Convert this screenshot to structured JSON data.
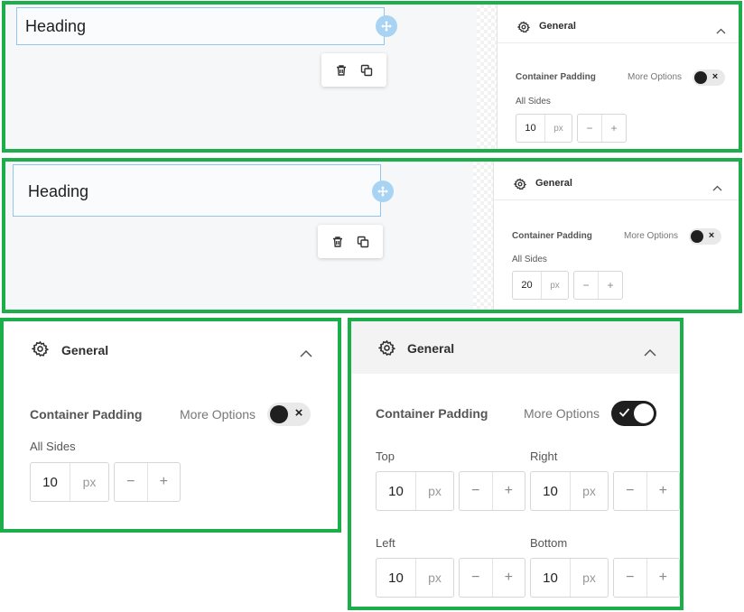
{
  "editor_views": [
    {
      "heading": "Heading",
      "panel": {
        "title": "General",
        "container_padding_label": "Container Padding",
        "more_options_label": "More Options",
        "more_options_state": "off",
        "all_sides_label": "All Sides",
        "value": "10",
        "unit": "px"
      }
    },
    {
      "heading": "Heading",
      "panel": {
        "title": "General",
        "container_padding_label": "Container Padding",
        "more_options_label": "More Options",
        "more_options_state": "off",
        "all_sides_label": "All Sides",
        "value": "20",
        "unit": "px"
      }
    }
  ],
  "panel_collapsed_options": {
    "title": "General",
    "container_padding_label": "Container Padding",
    "more_options_label": "More Options",
    "more_options_state": "off",
    "all_sides_label": "All Sides",
    "value": "10",
    "unit": "px",
    "minus": "−",
    "plus": "+"
  },
  "panel_expanded_options": {
    "title": "General",
    "container_padding_label": "Container Padding",
    "more_options_label": "More Options",
    "more_options_state": "on",
    "sides": [
      {
        "label": "Top",
        "value": "10",
        "unit": "px"
      },
      {
        "label": "Right",
        "value": "10",
        "unit": "px"
      },
      {
        "label": "Left",
        "value": "10",
        "unit": "px"
      },
      {
        "label": "Bottom",
        "value": "10",
        "unit": "px"
      }
    ],
    "minus": "−",
    "plus": "+"
  },
  "colors": {
    "frame_border": "#1cae4a",
    "selection_blue": "#93c6ee",
    "toggle_dark": "#1f1f1f"
  },
  "icons": {
    "gear": "gear-icon",
    "chevron": "chevron-up-icon",
    "move": "move-icon",
    "trash": "trash-icon",
    "duplicate": "duplicate-icon"
  }
}
